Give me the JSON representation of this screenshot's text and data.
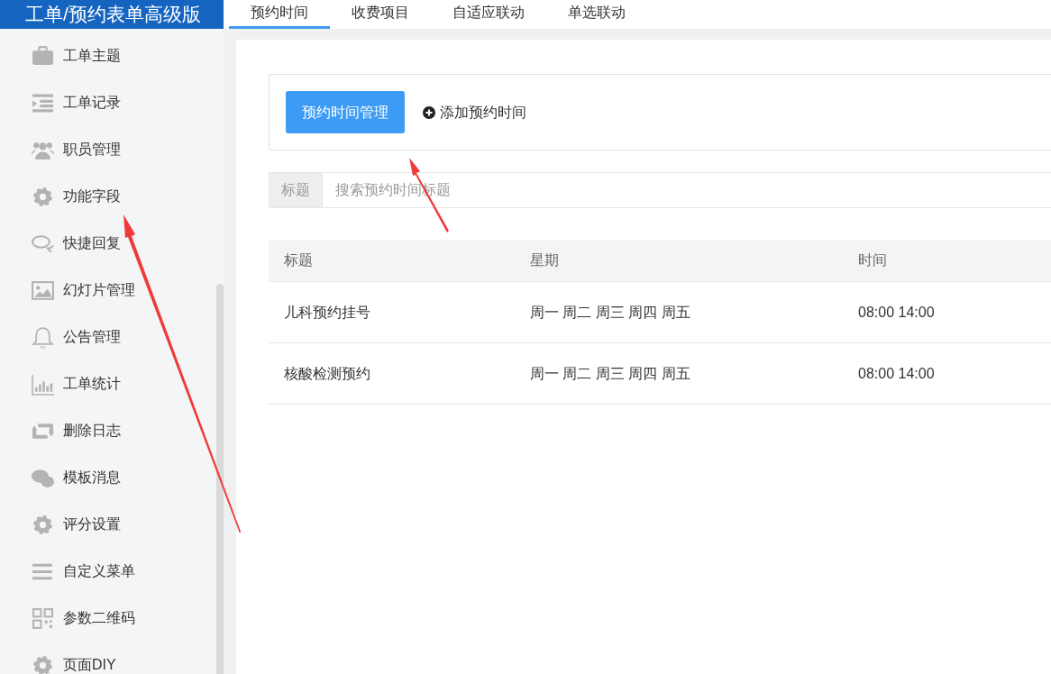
{
  "app_title": "工单/预约表单高级版",
  "sidebar": {
    "items": [
      {
        "label": "工单主题"
      },
      {
        "label": "工单记录"
      },
      {
        "label": "职员管理"
      },
      {
        "label": "功能字段"
      },
      {
        "label": "快捷回复"
      },
      {
        "label": "幻灯片管理"
      },
      {
        "label": "公告管理"
      },
      {
        "label": "工单统计"
      },
      {
        "label": "删除日志"
      },
      {
        "label": "模板消息"
      },
      {
        "label": "评分设置"
      },
      {
        "label": "自定义菜单"
      },
      {
        "label": "参数二维码"
      },
      {
        "label": "页面DIY"
      }
    ]
  },
  "tabs": [
    {
      "label": "预约时间",
      "selected": true
    },
    {
      "label": "收费项目",
      "selected": false
    },
    {
      "label": "自适应联动",
      "selected": false
    },
    {
      "label": "单选联动",
      "selected": false
    }
  ],
  "toolbar": {
    "primary_button": "预约时间管理",
    "add_link": "添加预约时间"
  },
  "search": {
    "label": "标题",
    "placeholder": "搜索预约时间标题"
  },
  "table": {
    "columns": [
      "标题",
      "星期",
      "时间"
    ],
    "rows": [
      [
        "儿科预约挂号",
        "周一 周二 周三 周四 周五",
        "08:00 14:00"
      ],
      [
        "核酸检测预约",
        "周一 周二 周三 周四 周五",
        "08:00 14:00"
      ]
    ]
  }
}
